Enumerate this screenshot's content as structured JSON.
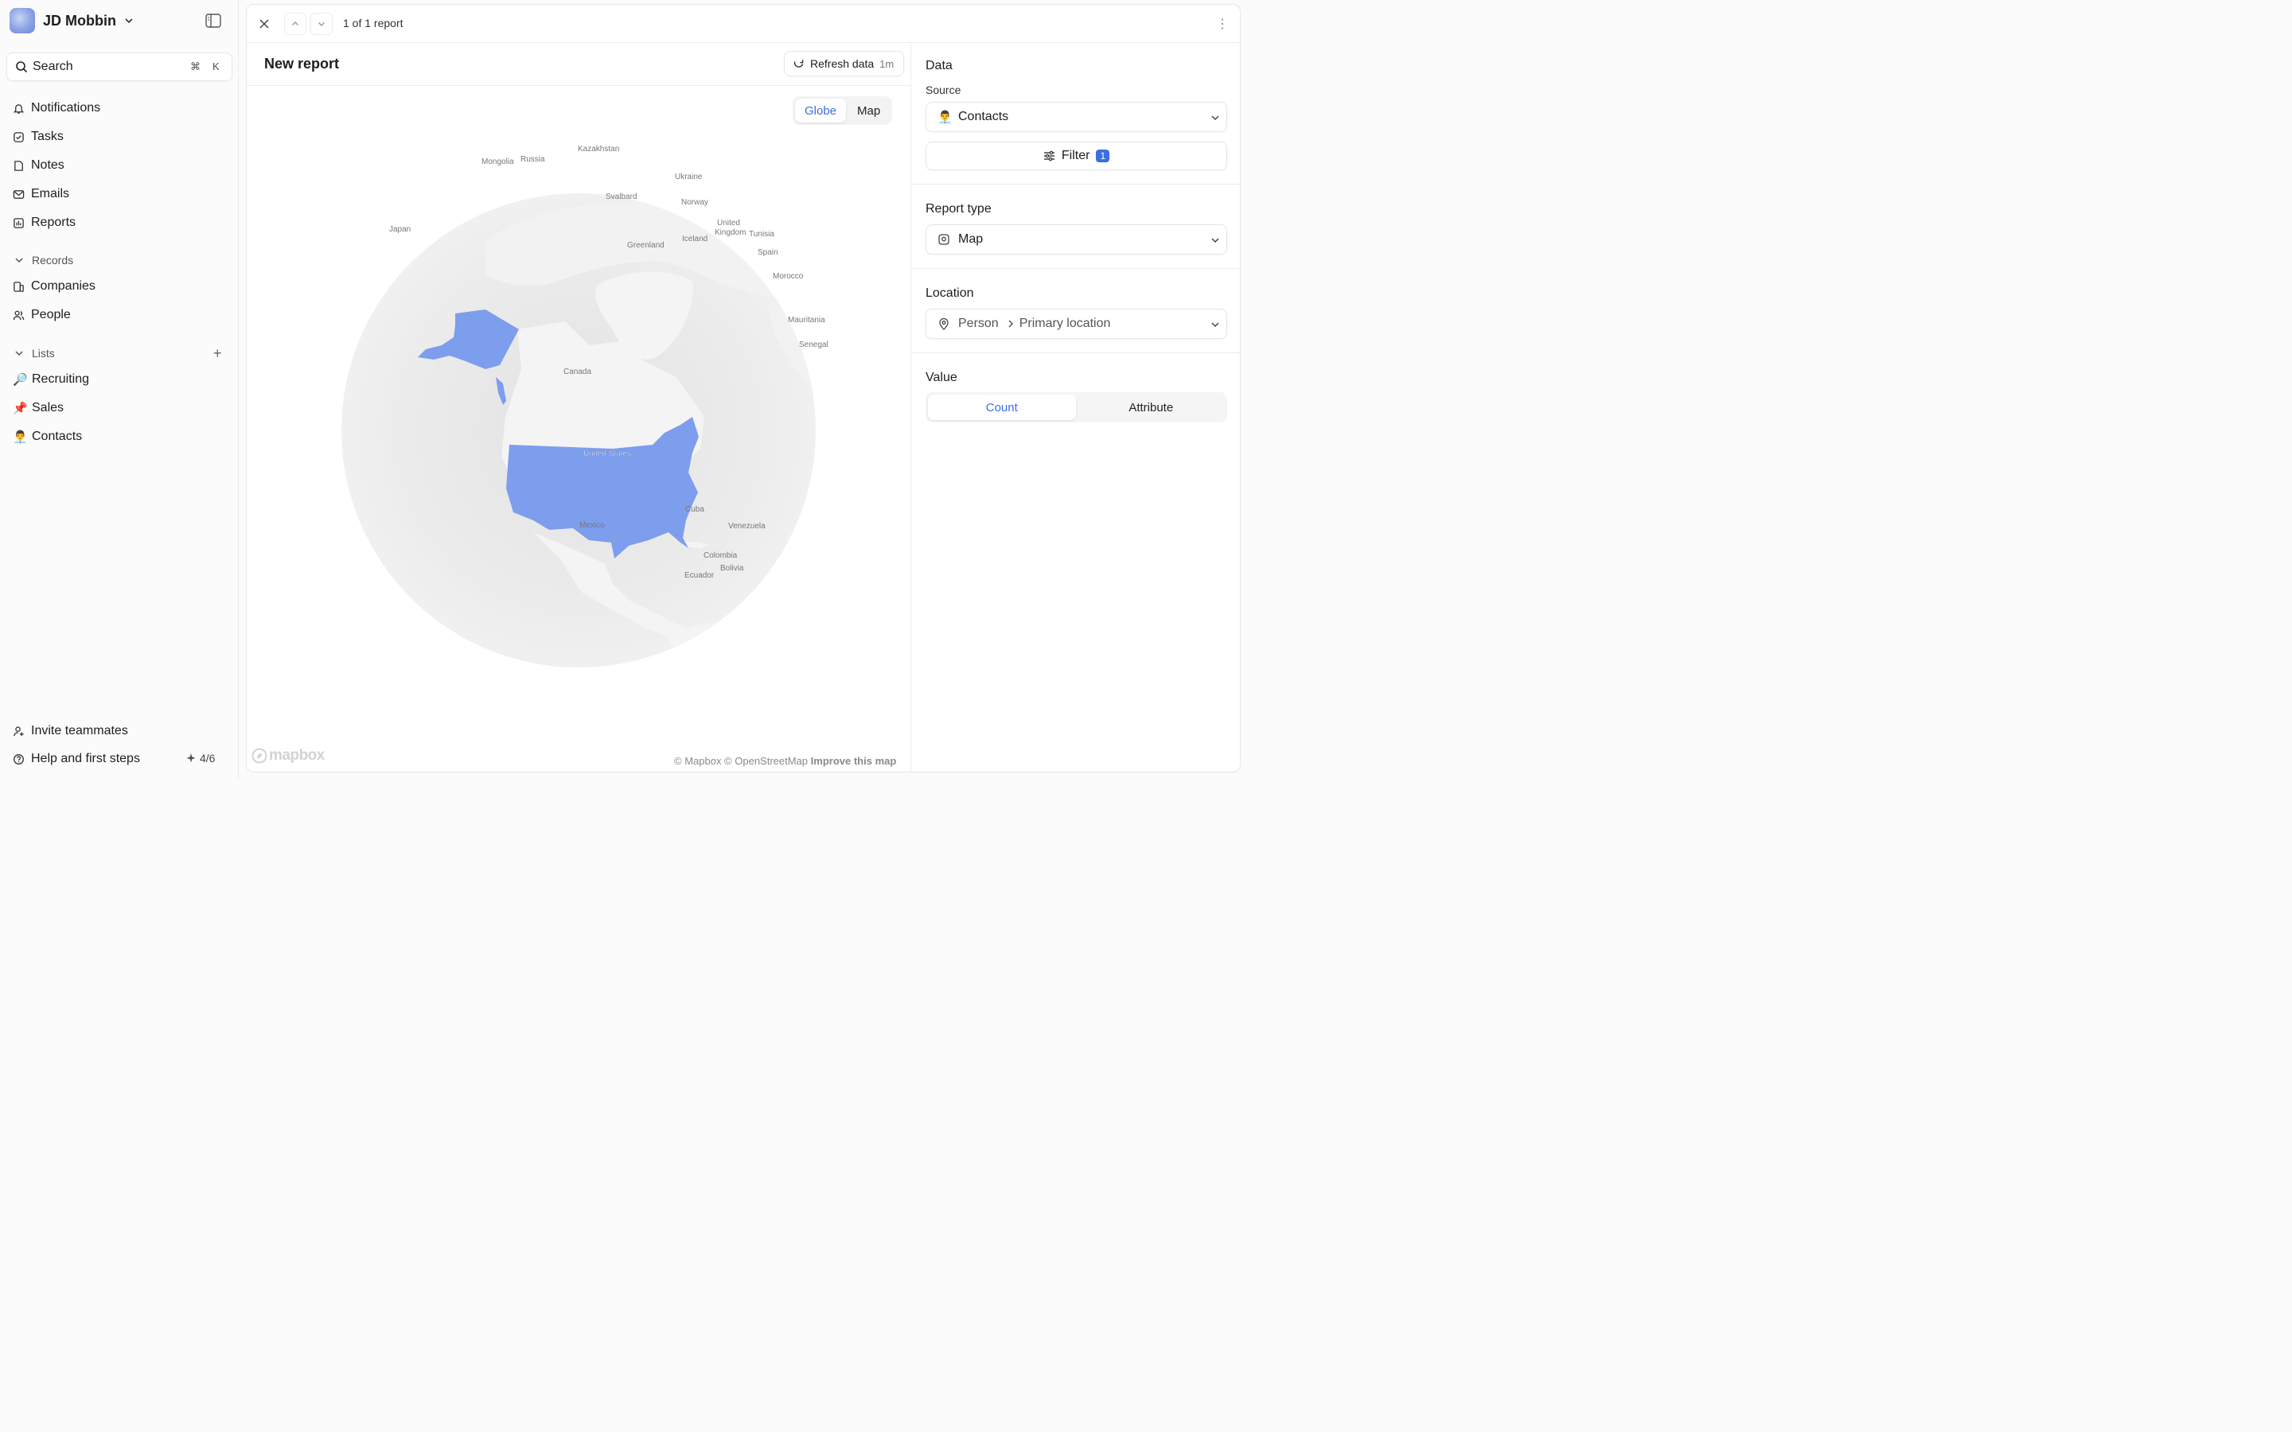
{
  "workspace": {
    "name": "JD Mobbin"
  },
  "search": {
    "label": "Search",
    "shortcut_cmd": "⌘",
    "shortcut_key": "K"
  },
  "nav": [
    {
      "label": "Notifications",
      "icon": "bell-icon"
    },
    {
      "label": "Tasks",
      "icon": "checkbox-icon"
    },
    {
      "label": "Notes",
      "icon": "note-icon"
    },
    {
      "label": "Emails",
      "icon": "mail-icon"
    },
    {
      "label": "Reports",
      "icon": "chart-icon"
    }
  ],
  "records": {
    "title": "Records",
    "items": [
      {
        "label": "Companies"
      },
      {
        "label": "People"
      }
    ]
  },
  "lists": {
    "title": "Lists",
    "items": [
      {
        "label": "Recruiting",
        "emoji": "🔎"
      },
      {
        "label": "Sales",
        "emoji": "📌"
      },
      {
        "label": "Contacts",
        "emoji": "👨‍💼"
      }
    ]
  },
  "footer": {
    "invite": "Invite teammates",
    "help": "Help and first steps",
    "progress": "4/6"
  },
  "topbar": {
    "count": "1 of 1 report"
  },
  "report": {
    "title": "New report",
    "refresh_label": "Refresh data",
    "refresh_age": "1m",
    "view_toggle": {
      "options": [
        "Globe",
        "Map"
      ],
      "selected": "Globe"
    }
  },
  "map": {
    "highlight_color": "#7d9ded",
    "highlighted_countries": [
      "United States"
    ],
    "labels": [
      "Kazakhstan",
      "Mongolia",
      "Russia",
      "Ukraine",
      "Svalbard",
      "Norway",
      "Japan",
      "United",
      "Kingdom",
      "Tunisia",
      "Greenland",
      "Iceland",
      "Spain",
      "Morocco",
      "Mauritania",
      "Senegal",
      "Canada",
      "United States",
      "Cuba",
      "Mexico",
      "Venezuela",
      "Colombia",
      "Bolivia",
      "Ecuador"
    ],
    "attribution": "© Mapbox © OpenStreetMap",
    "improve": "Improve this map",
    "logo": "mapbox"
  },
  "panel": {
    "data": {
      "title": "Data",
      "source_label": "Source",
      "source_value": "Contacts",
      "source_emoji": "👨‍💼",
      "filter_label": "Filter",
      "filter_count": "1"
    },
    "report_type": {
      "title": "Report type",
      "value": "Map"
    },
    "location": {
      "title": "Location",
      "entity": "Person",
      "field": "Primary location"
    },
    "value": {
      "title": "Value",
      "options": [
        "Count",
        "Attribute"
      ],
      "selected": "Count"
    }
  }
}
